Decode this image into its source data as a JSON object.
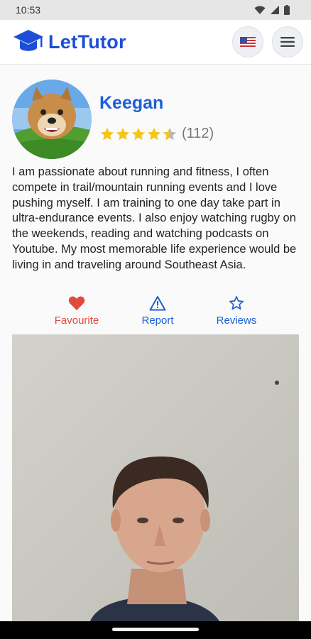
{
  "status_bar": {
    "time": "10:53"
  },
  "app": {
    "logo_text": "LetTutor",
    "brand_color": "#1d4ed8"
  },
  "tutor": {
    "name": "Keegan",
    "rating": 4.5,
    "rating_max": 5,
    "review_count_label": "(112)",
    "bio": "I am passionate about running and fitness, I often compete in trail/mountain running events and I love pushing myself. I am training to one day take part in ultra-endurance events. I also enjoy watching rugby on the weekends, reading and watching podcasts on Youtube. My most memorable life experience would be living in and traveling around Southeast Asia."
  },
  "actions": {
    "favourite_label": "Favourite",
    "report_label": "Report",
    "reviews_label": "Reviews"
  },
  "icons": {
    "logo": "graduation-cap-icon",
    "language": "us-flag-icon",
    "menu": "hamburger-menu-icon",
    "favourite": "heart-icon",
    "report": "warning-triangle-icon",
    "reviews": "star-outline-icon"
  },
  "colors": {
    "accent_blue": "#1d5fd6",
    "favourite_red": "#e24b3b",
    "star_yellow": "#f5c518"
  }
}
